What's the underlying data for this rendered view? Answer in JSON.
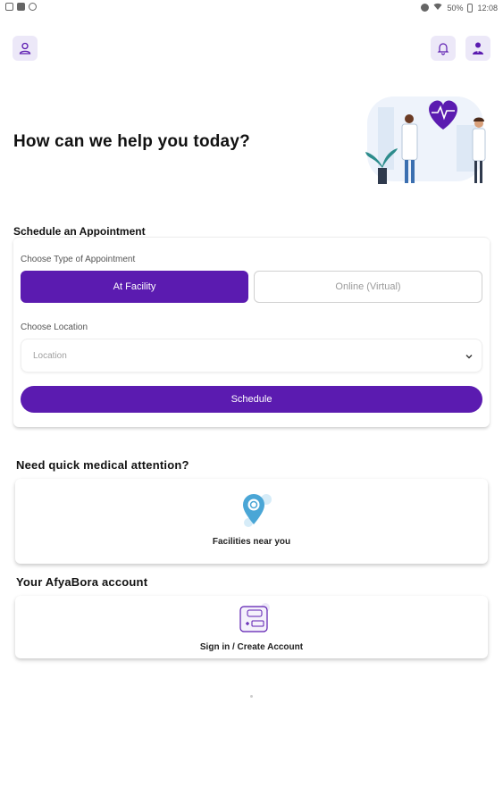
{
  "status_bar": {
    "battery": "50%",
    "time": "12:08"
  },
  "header": {
    "profile_icon": "user-icon",
    "notification_icon": "bell-icon",
    "doctor_icon": "doctor-icon"
  },
  "hero": {
    "title": "How can we help you today?"
  },
  "appointment": {
    "section_title": "Schedule an Appointment",
    "type_label": "Choose Type of Appointment",
    "type_options": [
      "At Facility",
      "Online (Virtual)"
    ],
    "selected_type": "At Facility",
    "location_label": "Choose Location",
    "location_placeholder": "Location",
    "schedule_button": "Schedule"
  },
  "quick": {
    "title": "Need quick medical attention?",
    "tile_label": "Facilities near you",
    "tile_icon": "location-pin-icon"
  },
  "account": {
    "title": "Your AfyaBora account",
    "tile_label": "Sign in / Create Account",
    "tile_icon": "id-card-icon"
  },
  "colors": {
    "primary": "#5b1bb0",
    "icon_bg": "#ece8f8",
    "accent_blue": "#4aa6d6"
  }
}
